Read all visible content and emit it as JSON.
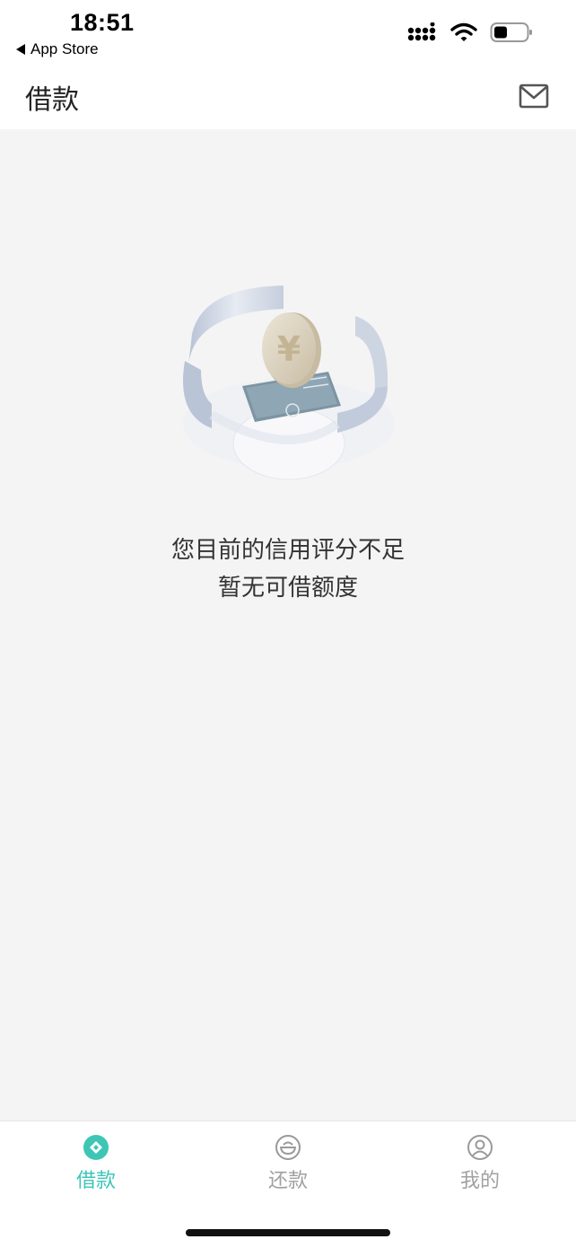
{
  "status_bar": {
    "time": "18:51",
    "back_label": "App Store"
  },
  "header": {
    "title": "借款",
    "mail_icon": "mail-icon"
  },
  "main": {
    "illustration_icon": "yen-coin-illustration",
    "message_line1": "您目前的信用评分不足",
    "message_line2": "暂无可借额度"
  },
  "tabs": [
    {
      "label": "借款",
      "icon": "loan-diamond-icon",
      "active": true
    },
    {
      "label": "还款",
      "icon": "repay-bowl-icon",
      "active": false
    },
    {
      "label": "我的",
      "icon": "profile-icon",
      "active": false
    }
  ],
  "colors": {
    "accent": "#3dc6b6",
    "inactive": "#a0a0a0",
    "content_bg": "#f4f4f4"
  }
}
